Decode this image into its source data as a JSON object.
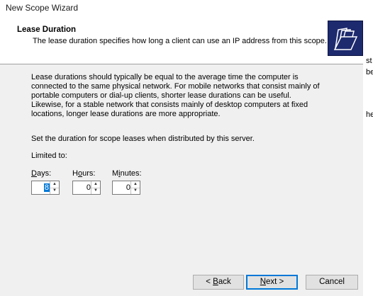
{
  "window": {
    "title": "New Scope Wizard"
  },
  "header": {
    "title": "Lease Duration",
    "subtitle": "The lease duration specifies how long a client can use an IP address from this scope."
  },
  "body": {
    "paragraph_lines": [
      "Lease durations should typically be equal to the average time the computer is",
      "connected to the same physical network. For mobile networks that consist mainly of",
      "portable computers or dial-up clients, shorter lease durations can be useful.",
      "Likewise, for a stable network that consists mainly of desktop computers at fixed",
      "locations, longer lease durations are more appropriate."
    ],
    "set_duration": "Set the duration for scope leases when distributed by this server.",
    "limited_to": "Limited to:"
  },
  "fields": {
    "days": {
      "label_accel": "D",
      "label_rest": "ays:",
      "value": "8"
    },
    "hours": {
      "label_pre": "H",
      "label_accel": "o",
      "label_rest": "urs:",
      "value": "0"
    },
    "minutes": {
      "label_pre": "M",
      "label_accel": "i",
      "label_rest": "nutes:",
      "value": "0"
    }
  },
  "buttons": {
    "back": {
      "prefix": "< ",
      "accel": "B",
      "rest": "ack"
    },
    "next": {
      "accel": "N",
      "rest": "ext >"
    },
    "cancel": "Cancel"
  },
  "background_fragments": [
    "st",
    "be",
    "he"
  ],
  "icons": {
    "wizard": "open-folder-icon",
    "spin_up": "up-arrow-icon",
    "spin_down": "down-arrow-icon"
  }
}
